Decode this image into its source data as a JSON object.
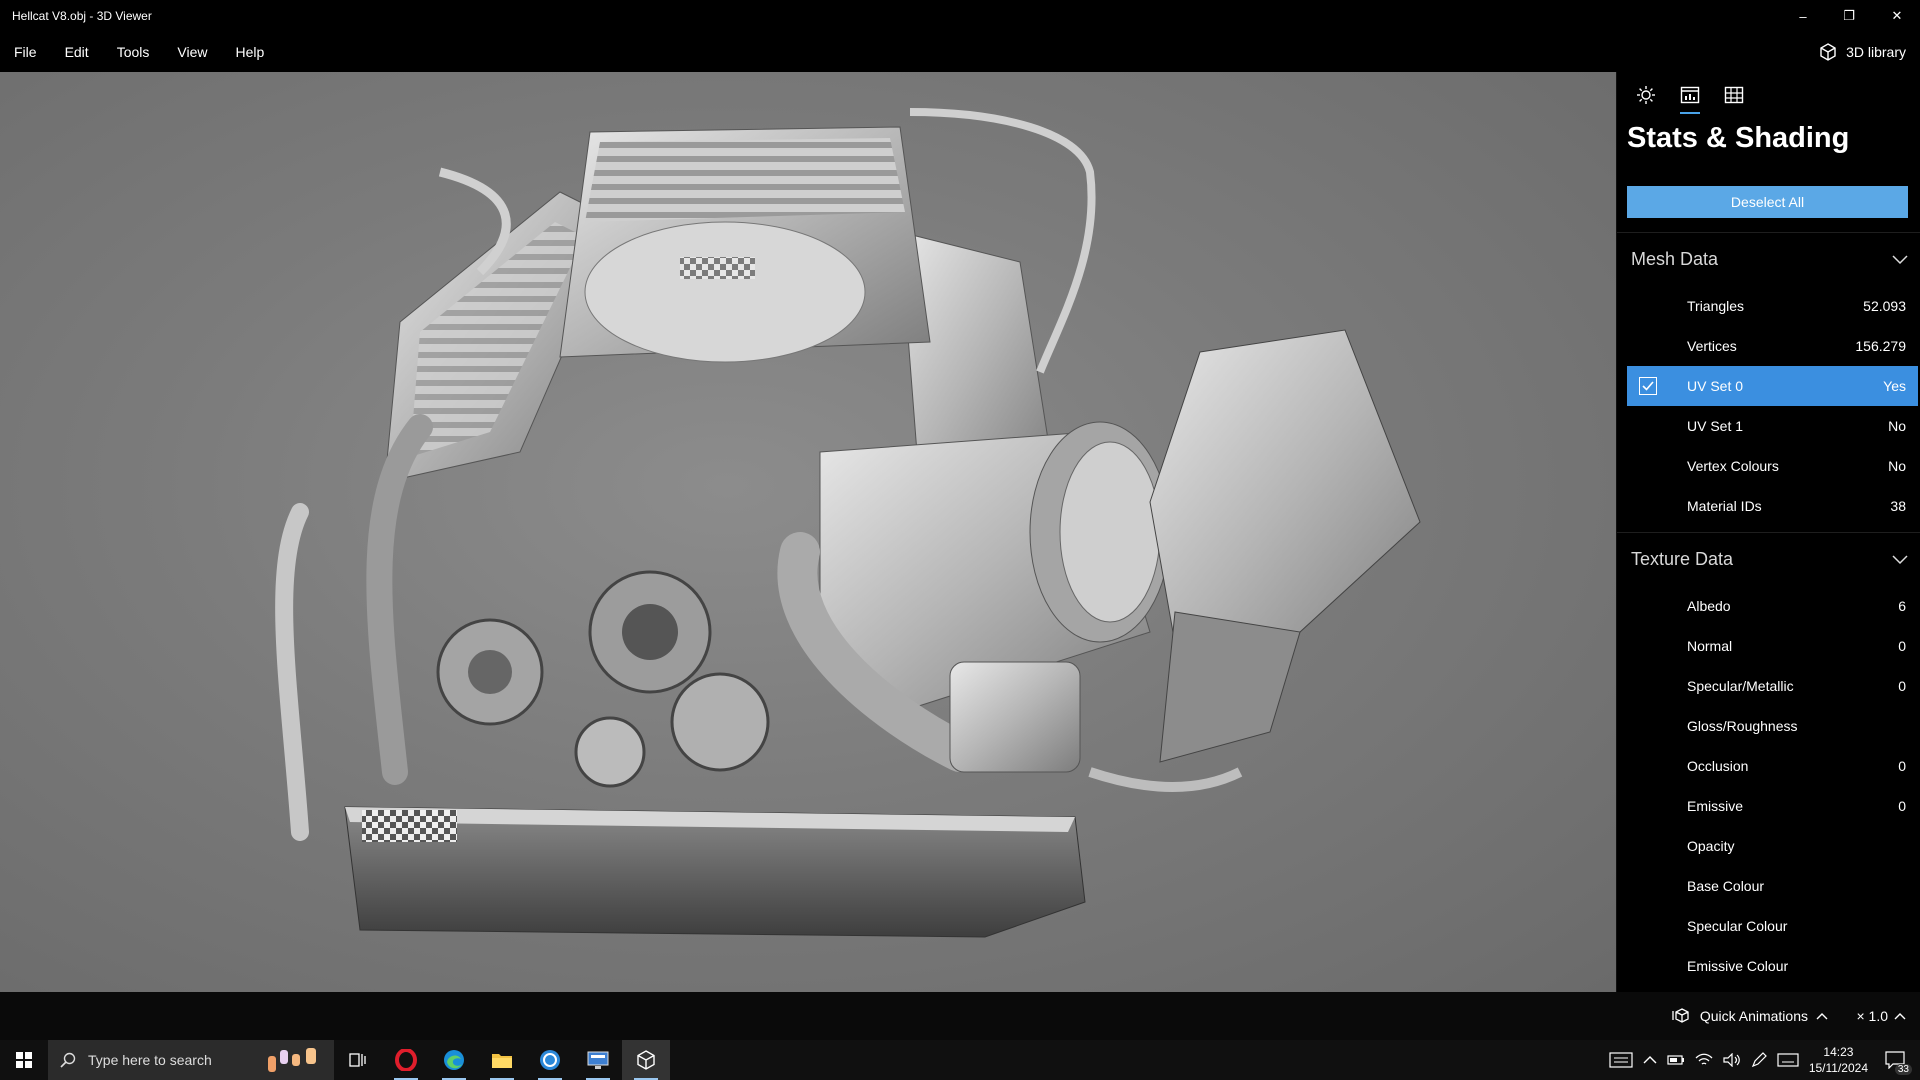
{
  "window": {
    "title": "Hellcat V8.obj - 3D Viewer",
    "controls": {
      "minimize": "–",
      "restore": "❐",
      "close": "✕"
    }
  },
  "menu": {
    "items": [
      "File",
      "Edit",
      "Tools",
      "View",
      "Help"
    ],
    "library_label": "3D library"
  },
  "panel": {
    "tabs": [
      "sun-icon",
      "stats-icon",
      "grid-icon"
    ],
    "active_tab": 1,
    "title": "Stats & Shading",
    "deselect_label": "Deselect All",
    "mesh": {
      "header": "Mesh Data",
      "rows": [
        {
          "label": "Triangles",
          "value": "52.093"
        },
        {
          "label": "Vertices",
          "value": "156.279"
        },
        {
          "label": "UV Set 0",
          "value": "Yes",
          "selected": true
        },
        {
          "label": "UV Set 1",
          "value": "No"
        },
        {
          "label": "Vertex Colours",
          "value": "No"
        },
        {
          "label": "Material IDs",
          "value": "38"
        }
      ]
    },
    "texture": {
      "header": "Texture Data",
      "rows": [
        {
          "label": "Albedo",
          "value": "6"
        },
        {
          "label": "Normal",
          "value": "0"
        },
        {
          "label": "Specular/Metallic",
          "value": "0"
        },
        {
          "label": "Gloss/Roughness",
          "value": ""
        },
        {
          "label": "Occlusion",
          "value": "0"
        },
        {
          "label": "Emissive",
          "value": "0"
        },
        {
          "label": "Opacity",
          "value": ""
        },
        {
          "label": "Base Colour",
          "value": ""
        },
        {
          "label": "Specular Colour",
          "value": ""
        },
        {
          "label": "Emissive Colour",
          "value": ""
        }
      ]
    }
  },
  "bottom": {
    "quick_animations": "Quick Animations",
    "speed": "× 1.0"
  },
  "taskbar": {
    "search_placeholder": "Type here to search",
    "time": "14:23",
    "date": "15/11/2024",
    "notification_count": "33"
  },
  "colors": {
    "accent": "#5ba8e6",
    "selected_row": "#3b8fe0",
    "viewport_bg": "#7b7b7b"
  }
}
